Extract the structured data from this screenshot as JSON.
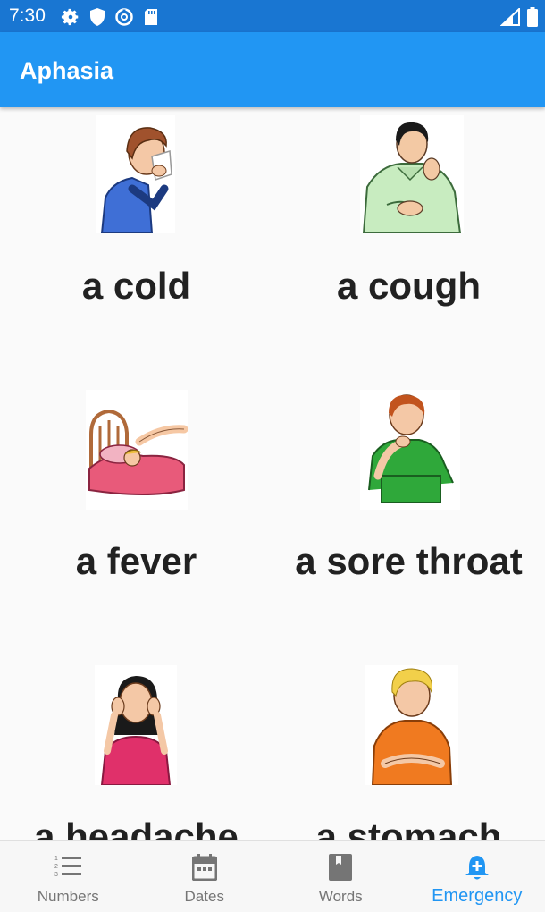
{
  "status_bar": {
    "time": "7:30"
  },
  "app_bar": {
    "title": "Aphasia"
  },
  "cards": [
    {
      "label": "a cold"
    },
    {
      "label": "a cough"
    },
    {
      "label": "a fever"
    },
    {
      "label": "a sore throat"
    },
    {
      "label": "a headache"
    },
    {
      "label": "a stomach"
    }
  ],
  "bottom_nav": {
    "items": [
      {
        "label": "Numbers",
        "icon": "numbered-list-icon"
      },
      {
        "label": "Dates",
        "icon": "calendar-icon"
      },
      {
        "label": "Words",
        "icon": "book-icon"
      },
      {
        "label": "Emergency",
        "icon": "bell-plus-icon"
      }
    ],
    "active": "Emergency"
  },
  "colors": {
    "status_bar": "#1976d2",
    "app_bar": "#2196f3",
    "active_nav": "#2196f3",
    "inactive_nav": "#757575"
  }
}
